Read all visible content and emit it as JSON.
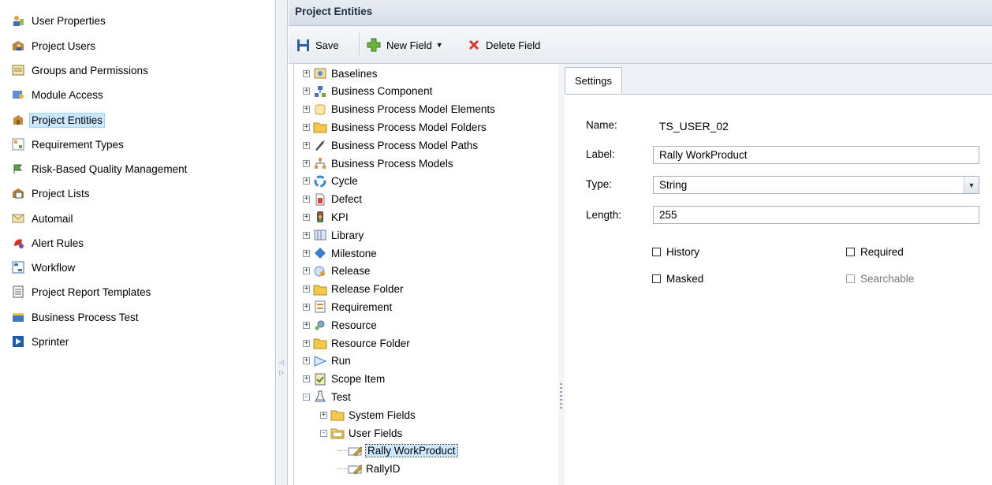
{
  "nav": {
    "items": [
      {
        "label": "User Properties",
        "icon": "user-properties-icon"
      },
      {
        "label": "Project Users",
        "icon": "project-users-icon"
      },
      {
        "label": "Groups and Permissions",
        "icon": "groups-icon"
      },
      {
        "label": "Module Access",
        "icon": "module-access-icon"
      },
      {
        "label": "Project Entities",
        "icon": "project-entities-icon",
        "selected": true
      },
      {
        "label": "Requirement Types",
        "icon": "requirement-types-icon"
      },
      {
        "label": "Risk-Based Quality Management",
        "icon": "risk-icon"
      },
      {
        "label": "Project Lists",
        "icon": "project-lists-icon"
      },
      {
        "label": "Automail",
        "icon": "automail-icon"
      },
      {
        "label": "Alert Rules",
        "icon": "alert-rules-icon"
      },
      {
        "label": "Workflow",
        "icon": "workflow-icon"
      },
      {
        "label": "Project Report Templates",
        "icon": "report-templates-icon"
      },
      {
        "label": "Business Process Test",
        "icon": "bpt-icon"
      },
      {
        "label": "Sprinter",
        "icon": "sprinter-icon"
      }
    ]
  },
  "panel_title": "Project Entities",
  "toolbar": {
    "save_label": "Save",
    "new_field_label": "New Field",
    "delete_field_label": "Delete Field"
  },
  "tree": {
    "items": [
      {
        "label": "Baselines",
        "icon": "baselines-icon",
        "level": 0,
        "expander": "+"
      },
      {
        "label": "Business Component",
        "icon": "business-component-icon",
        "level": 0,
        "expander": "+"
      },
      {
        "label": "Business Process Model Elements",
        "icon": "bpm-elements-icon",
        "level": 0,
        "expander": "+"
      },
      {
        "label": "Business Process Model Folders",
        "icon": "folder-icon",
        "level": 0,
        "expander": "+"
      },
      {
        "label": "Business Process Model Paths",
        "icon": "bpm-paths-icon",
        "level": 0,
        "expander": "+"
      },
      {
        "label": "Business Process Models",
        "icon": "bpm-models-icon",
        "level": 0,
        "expander": "+"
      },
      {
        "label": "Cycle",
        "icon": "cycle-icon",
        "level": 0,
        "expander": "+"
      },
      {
        "label": "Defect",
        "icon": "defect-icon",
        "level": 0,
        "expander": "+"
      },
      {
        "label": "KPI",
        "icon": "kpi-icon",
        "level": 0,
        "expander": "+"
      },
      {
        "label": "Library",
        "icon": "library-icon",
        "level": 0,
        "expander": "+"
      },
      {
        "label": "Milestone",
        "icon": "milestone-icon",
        "level": 0,
        "expander": "+"
      },
      {
        "label": "Release",
        "icon": "release-icon",
        "level": 0,
        "expander": "+"
      },
      {
        "label": "Release Folder",
        "icon": "folder-icon",
        "level": 0,
        "expander": "+"
      },
      {
        "label": "Requirement",
        "icon": "requirement-icon",
        "level": 0,
        "expander": "+"
      },
      {
        "label": "Resource",
        "icon": "resource-icon",
        "level": 0,
        "expander": "+"
      },
      {
        "label": "Resource Folder",
        "icon": "folder-icon",
        "level": 0,
        "expander": "+"
      },
      {
        "label": "Run",
        "icon": "run-icon",
        "level": 0,
        "expander": "+"
      },
      {
        "label": "Scope Item",
        "icon": "scope-item-icon",
        "level": 0,
        "expander": "+"
      },
      {
        "label": "Test",
        "icon": "test-icon",
        "level": 0,
        "expander": "-"
      },
      {
        "label": "System Fields",
        "icon": "folder-icon",
        "level": 1,
        "expander": "+"
      },
      {
        "label": "User Fields",
        "icon": "folder-open-icon",
        "level": 1,
        "expander": "-"
      },
      {
        "label": "Rally WorkProduct",
        "icon": "field-icon",
        "level": 2,
        "expander": "",
        "selected": true
      },
      {
        "label": "RallyID",
        "icon": "field-icon",
        "level": 2,
        "expander": ""
      }
    ]
  },
  "settings": {
    "tab_label": "Settings",
    "name_label": "Name:",
    "name_value": "TS_USER_02",
    "label_label": "Label:",
    "label_value": "Rally WorkProduct",
    "type_label": "Type:",
    "type_value": "String",
    "length_label": "Length:",
    "length_value": "255",
    "history_label": "History",
    "required_label": "Required",
    "masked_label": "Masked",
    "searchable_label": "Searchable"
  }
}
